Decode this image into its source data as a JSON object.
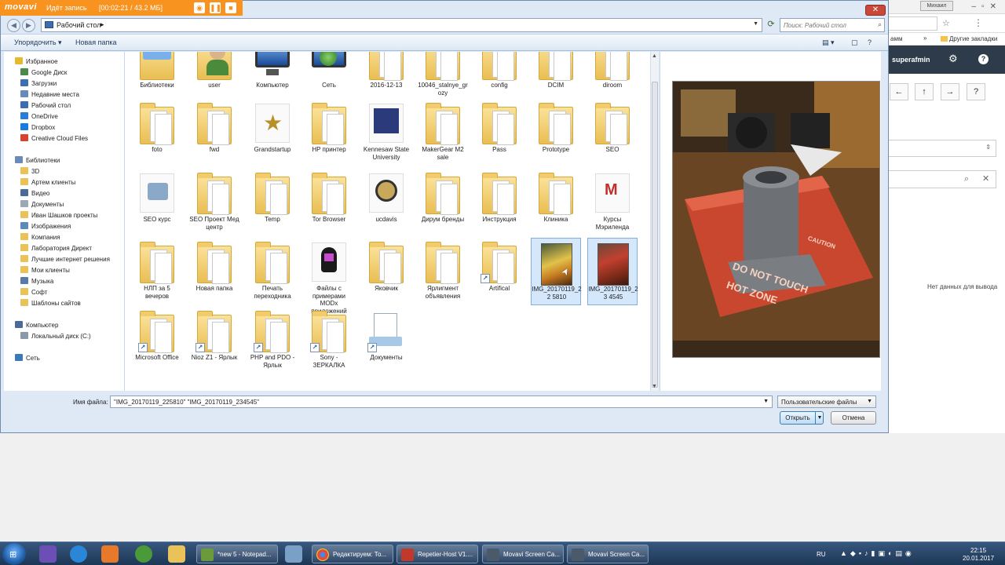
{
  "recorder": {
    "logo": "movavi",
    "status": "Идёт запись",
    "elapsed": "[00:02:21 / 43.2 МБ]"
  },
  "window": {
    "close_glyph": "✕"
  },
  "address": {
    "location": "Рабочий стол",
    "separator": "▸",
    "search_placeholder": "Поиск: Рабочий стол"
  },
  "toolbar": {
    "organize": "Упорядочить ▾",
    "new_folder": "Новая папка"
  },
  "navpane": {
    "favorites": [
      {
        "label": "Избранное",
        "icon": "star-icon",
        "color": "#e8b830"
      },
      {
        "label": "Google Диск",
        "icon": "google-drive-icon",
        "color": "#4a8a4a"
      },
      {
        "label": "Загрузки",
        "icon": "downloads-icon",
        "color": "#3c6fb0"
      },
      {
        "label": "Недавние места",
        "icon": "recent-places-icon",
        "color": "#6a8ab8"
      },
      {
        "label": "Рабочий стол",
        "icon": "desktop-icon",
        "color": "#3b6db0"
      },
      {
        "label": "OneDrive",
        "icon": "onedrive-icon",
        "color": "#2a7fd4"
      },
      {
        "label": "Dropbox",
        "icon": "dropbox-icon",
        "color": "#1a7ae0"
      },
      {
        "label": "Creative Cloud Files",
        "icon": "creative-cloud-icon",
        "color": "#d9422e"
      }
    ],
    "libraries": [
      {
        "label": "Библиотеки",
        "icon": "libraries-icon",
        "color": "#6a8ab8"
      },
      {
        "label": "3D",
        "icon": "folder-icon",
        "color": "#e9c25a"
      },
      {
        "label": "Артем клиенты",
        "icon": "folder-icon",
        "color": "#e9c25a"
      },
      {
        "label": "Видео",
        "icon": "video-icon",
        "color": "#4a6a9a"
      },
      {
        "label": "Документы",
        "icon": "documents-icon",
        "color": "#9aa8b8"
      },
      {
        "label": "Иван Шашков проекты",
        "icon": "folder-icon",
        "color": "#e9c25a"
      },
      {
        "label": "Изображения",
        "icon": "pictures-icon",
        "color": "#5a8ab8"
      },
      {
        "label": "Компания",
        "icon": "folder-icon",
        "color": "#e9c25a"
      },
      {
        "label": "Лаборатория Директ",
        "icon": "folder-icon",
        "color": "#e9c25a"
      },
      {
        "label": "Лучшие интернет решения",
        "icon": "folder-icon",
        "color": "#e9c25a"
      },
      {
        "label": "Мои клиенты",
        "icon": "folder-icon",
        "color": "#e9c25a"
      },
      {
        "label": "Музыка",
        "icon": "music-icon",
        "color": "#5a7aa8"
      },
      {
        "label": "Софт",
        "icon": "folder-icon",
        "color": "#e9c25a"
      },
      {
        "label": "Шаблоны сайтов",
        "icon": "folder-icon",
        "color": "#e9c25a"
      }
    ],
    "computer": [
      {
        "label": "Компьютер",
        "icon": "computer-icon",
        "color": "#4a6a9a"
      },
      {
        "label": "Локальный диск (C:)",
        "icon": "drive-icon",
        "color": "#8a9aa8"
      }
    ],
    "network": [
      {
        "label": "Сеть",
        "icon": "network-icon",
        "color": "#3a7ab8"
      }
    ]
  },
  "files": {
    "row0": [
      "Библиотеки",
      "user",
      "Компьютер",
      "Сеть",
      "2016-12-13",
      "10046_stalnye_gr ozy",
      "config",
      "DCIM",
      "diroom"
    ],
    "row1": [
      "foto",
      "fwd",
      "Grandstartup",
      "HP принтер",
      "Kennesaw State University",
      "MakerGear M2 sale",
      "Pass",
      "Prototype",
      "SEO"
    ],
    "row2": [
      "SEO курс",
      "SEO Проект Мед центр",
      "Temp",
      "Tor Browser",
      "ucdavis",
      "Дирум бренды",
      "Инструкция",
      "Клиника",
      "Курсы Мэриленда"
    ],
    "row3": [
      "НЛП за 5 вечеров",
      "Новая папка",
      "Печать переходника",
      "Файлы с примерами MODx приложений",
      "Яковчик",
      "Ярлигмент объявления",
      "Artifical",
      "IMG_20170119_22 5810",
      "IMG_20170119_23 4545"
    ],
    "row4": [
      "Microsoft Office",
      "Nioz Z1 - Ярлык",
      "PHP and PDO - Ярлык",
      "Sony - ЗЕРКАЛКА",
      "Документы"
    ]
  },
  "preview": {
    "caption_lines": [
      "DO NOT TOUCH",
      "HOT ZONE",
      "CAUTION"
    ]
  },
  "footer": {
    "filename_label": "Имя файла:",
    "filename_value": "\"IMG_20170119_225810\" \"IMG_20170119_234545\"",
    "filetype": "Пользовательские файлы",
    "open": "Открыть",
    "cancel": "Отмена"
  },
  "browser": {
    "user_chip": "Михаил",
    "bookmark_cut": "амм",
    "bookmark_more": "»",
    "other_bookmarks": "Другие закладки",
    "username": "superafmin",
    "no_data": "Нет данных для вывода"
  },
  "taskbar": {
    "tasks": [
      {
        "label": "*new 5 - Notepad...",
        "color": "#6a9a3a"
      },
      {
        "label": "Редактируем: То...",
        "color": "#d8d8d8"
      },
      {
        "label": "Repetier-Host V1....",
        "color": "#c0392b"
      },
      {
        "label": "Movavi Screen Ca...",
        "color": "#4a5a6a"
      },
      {
        "label": "Movavi Screen Ca...",
        "color": "#4a5a6a"
      }
    ],
    "lang": "RU",
    "time": "22:15",
    "date": "20.01.2017"
  }
}
